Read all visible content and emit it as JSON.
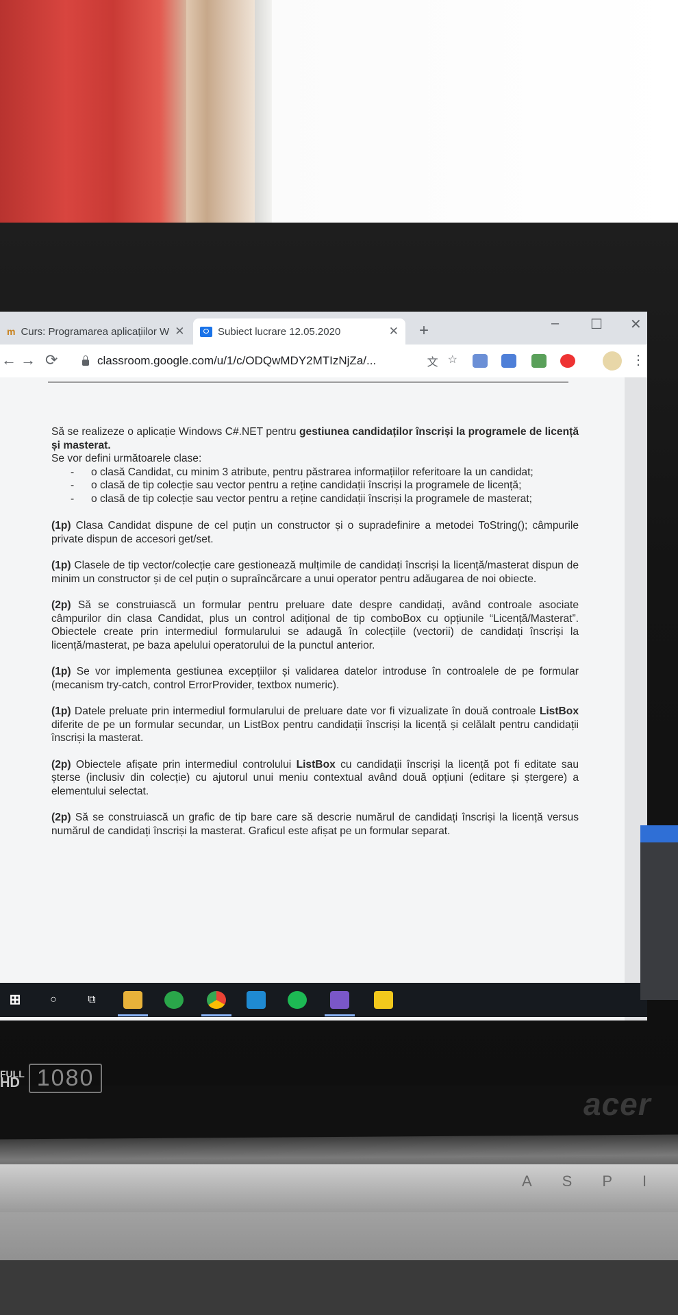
{
  "browser": {
    "tabs": [
      {
        "label": "Curs: Programarea aplicațiilor W",
        "active": false
      },
      {
        "label": "Subiect lucrare 12.05.2020",
        "active": true
      }
    ],
    "tab_close": "✕",
    "new_tab": "+",
    "window_controls": {
      "minimize": "–",
      "maximize": "☐",
      "close": "✕"
    },
    "url": "classroom.google.com/u/1/c/ODQwMDY2MTIzNjZa/...",
    "nav": {
      "back": "←",
      "forward": "→",
      "reload": "⟳"
    },
    "menu": "⋮"
  },
  "document": {
    "intro_plain": "Să se realizeze o aplicație Windows C#.NET pentru ",
    "intro_bold": "gestiunea candidaților înscriși la programele de licență și masterat.",
    "classes_intro": "Se vor defini următoarele clase:",
    "classes": [
      "o clasă Candidat, cu minim 3 atribute, pentru păstrarea informațiilor referitoare la un candidat;",
      "o clasă de tip colecție sau vector pentru a reține candidații înscriși la programele de licență;",
      "o clasă de tip colecție sau vector pentru a reține candidații înscriși la programele de masterat;"
    ],
    "requirements": [
      {
        "points": "(1p)",
        "text": " Clasa Candidat dispune de cel puțin un constructor și o supradefinire a metodei ToString(); câmpurile private dispun de accesori get/set."
      },
      {
        "points": "(1p)",
        "text": " Clasele de tip vector/colecție care gestionează mulțimile de candidați înscriși la licență/masterat dispun de minim un constructor și de cel puțin o supraîncărcare a unui operator pentru adăugarea de noi obiecte."
      },
      {
        "points": "(2p)",
        "text": " Să se construiască un formular pentru preluare date despre candidați, având controale asociate câmpurilor din clasa Candidat, plus un control adițional de tip comboBox cu opțiunile “Licență/Masterat”. Obiectele create prin intermediul formularului se adaugă în colecțiile (vectorii) de candidați înscriși la licență/masterat, pe baza apelului operatorului de la punctul anterior."
      },
      {
        "points": "(1p)",
        "text": " Se vor implementa gestiunea excepțiilor și validarea datelor introduse în controalele de pe formular (mecanism try-catch, control ErrorProvider, textbox numeric)."
      },
      {
        "points": "(1p)",
        "text_a": " Datele preluate prin intermediul formularului de preluare date vor fi vizualizate în două controale ",
        "bold": "ListBox",
        "text_b": " diferite de pe un formular secundar, un ListBox pentru candidații înscriși la licență și celălalt pentru candidații înscriși la masterat."
      },
      {
        "points": "(2p)",
        "text_a": " Obiectele afișate prin intermediul controlului ",
        "bold": "ListBox",
        "text_b": " cu candidații înscriși la licență pot fi editate sau șterse (inclusiv din colecție) cu ajutorul unui meniu contextual având două opțiuni (editare și ștergere) a elementului selectat."
      },
      {
        "points": "(2p)",
        "text": " Să se construiască un grafic de tip bare care să descrie numărul de candidați înscriși la licență versus numărul de candidați înscriși la masterat. Graficul este afișat pe un formular separat."
      }
    ],
    "help": "?"
  },
  "taskbar": {
    "icons": [
      "windows-icon",
      "search-icon",
      "task-view-icon",
      "file-explorer-icon",
      "whatsapp-icon",
      "chrome-icon",
      "vscode-icon",
      "spotify-icon",
      "visual-studio-icon",
      "sticky-notes-icon"
    ]
  },
  "monitor": {
    "badge_top": "FULL",
    "badge_bottom": "HD",
    "resolution": "1080",
    "brand": "acer",
    "keyboard_letters": "ASPI"
  },
  "colors": {
    "curtain": "#c93a35",
    "taskbar": "#161a1f",
    "chrome_blue": "#1a73e8"
  }
}
